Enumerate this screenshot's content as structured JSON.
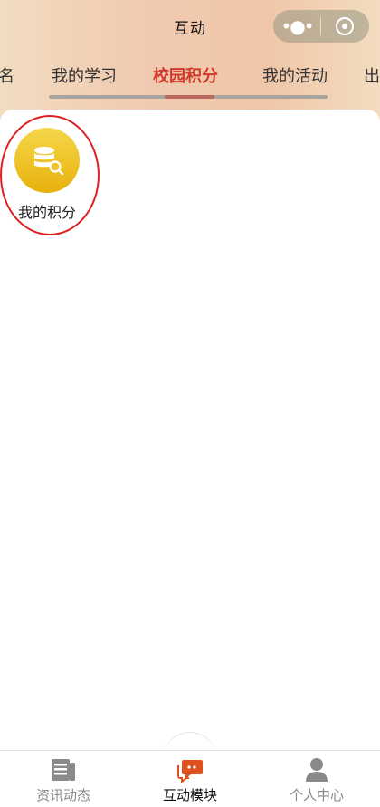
{
  "header": {
    "title": "互动"
  },
  "capsule": {
    "more_icon": "more-dots-icon",
    "close_icon": "target-icon"
  },
  "tabs": [
    {
      "label": "名",
      "active": false
    },
    {
      "label": "我的学习",
      "active": false
    },
    {
      "label": "校园积分",
      "active": true
    },
    {
      "label": "我的活动",
      "active": false
    },
    {
      "label": "出",
      "active": false
    }
  ],
  "grid": {
    "items": [
      {
        "label": "我的积分",
        "icon": "database-search-icon"
      }
    ]
  },
  "bottom_nav": {
    "items": [
      {
        "label": "资讯动态",
        "icon": "news-icon",
        "active": false
      },
      {
        "label": "互动模块",
        "icon": "chat-bubble-icon",
        "active": true
      },
      {
        "label": "个人中心",
        "icon": "user-icon",
        "active": false
      }
    ]
  },
  "colors": {
    "accent": "#d0392b",
    "points_icon": "#efc42a",
    "highlight": "#e02020"
  }
}
